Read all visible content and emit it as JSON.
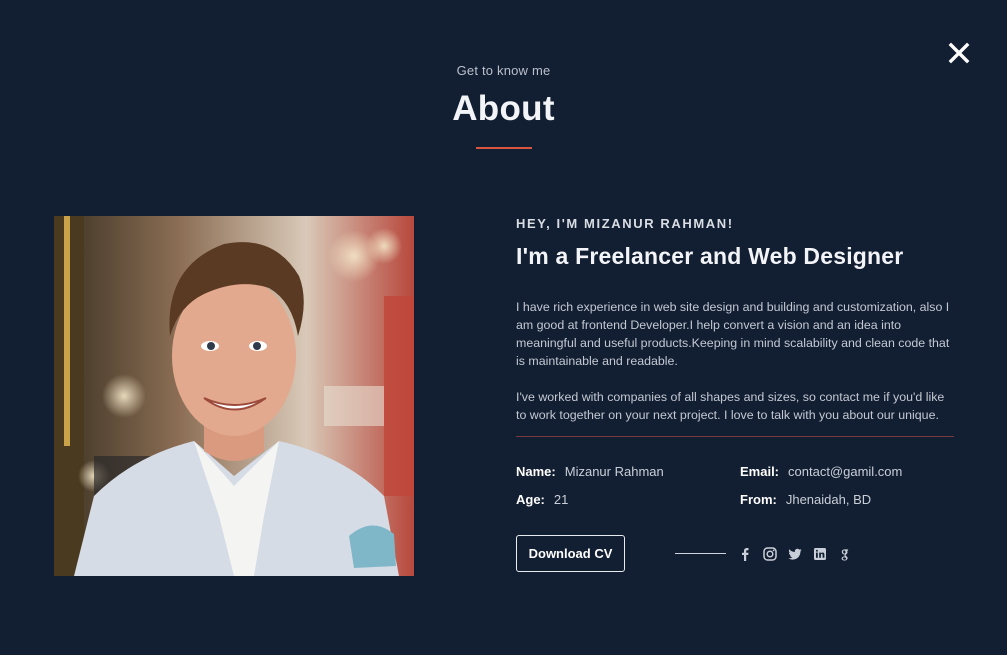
{
  "header": {
    "eyebrow": "Get to know me",
    "title": "About"
  },
  "close": {
    "icon": "close-icon"
  },
  "profile": {
    "photo_icon": "profile-photo",
    "greeting": "HEY, I'M MIZANUR RAHMAN!",
    "headline": "I'm a Freelancer and Web Designer",
    "bio": [
      "I have rich experience in web site design and building and customization, also I am good at frontend Developer.I help convert a vision and an idea into meaningful and useful products.Keeping in mind scalability and clean code that is maintainable and readable.",
      "I've worked with companies of all shapes and sizes, so contact me if you'd like to work together on your next project. I love to talk with you about our unique."
    ]
  },
  "info": {
    "name_label": "Name:",
    "name_value": "Mizanur Rahman",
    "email_label": "Email:",
    "email_value": "contact@gamil.com",
    "age_label": "Age:",
    "age_value": "21",
    "from_label": "From:",
    "from_value": "Jhenaidah, BD"
  },
  "actions": {
    "download_label": "Download CV",
    "socials": [
      "facebook-icon",
      "instagram-icon",
      "twitter-icon",
      "linkedin-icon",
      "google-icon"
    ]
  },
  "colors": {
    "background": "#121e31",
    "accent": "#d9553f",
    "divider": "#7a3b3f"
  }
}
